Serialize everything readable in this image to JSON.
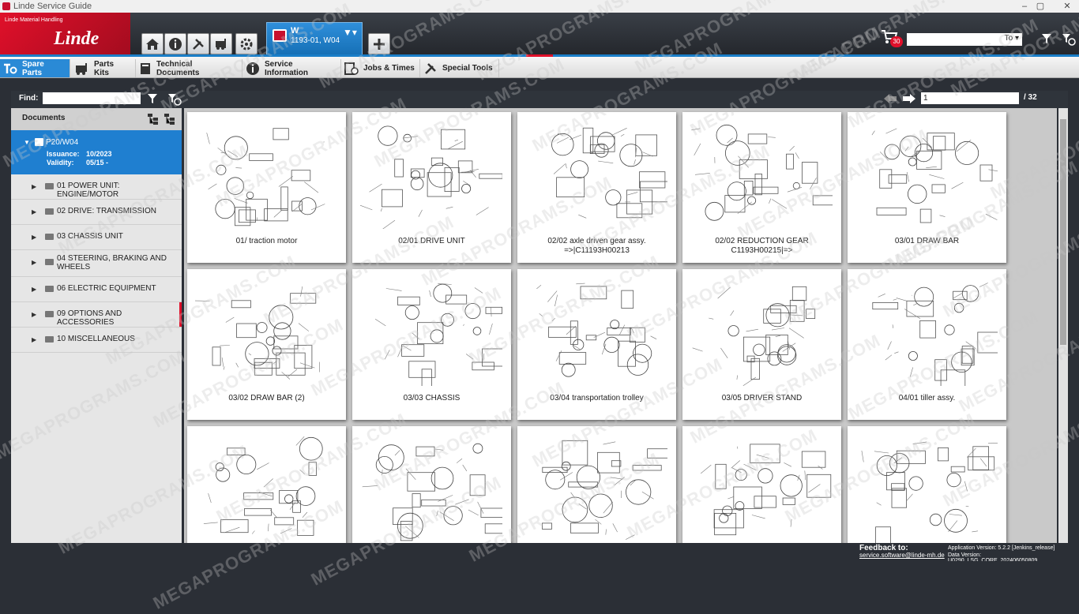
{
  "window": {
    "title": "Linde Service Guide",
    "controls": [
      "–",
      "▢",
      "✕"
    ]
  },
  "brand": {
    "tagline": "Linde Material Handling",
    "logo_text": "Linde"
  },
  "header_buttons": [
    "home-icon",
    "info-icon",
    "tools-icon",
    "truck-icon",
    "settings-icon"
  ],
  "vehicle_tab": {
    "line1": "W",
    "line2": "1193-01, W04"
  },
  "cart": {
    "count": "30"
  },
  "search": {
    "scope": "To"
  },
  "tabs": [
    {
      "label": "Spare Parts",
      "icon": "spare-parts-icon"
    },
    {
      "label": "Parts Kits",
      "icon": "parts-kits-icon"
    },
    {
      "label": "Technical Documents",
      "icon": "book-icon"
    },
    {
      "label": "Service Information",
      "icon": "info-icon"
    },
    {
      "label": "Jobs & Times",
      "icon": "jobs-icon"
    },
    {
      "label": "Special Tools",
      "icon": "tools-icon"
    }
  ],
  "find": {
    "label": "Find:",
    "value": ""
  },
  "pager": {
    "current": "1",
    "total": "/ 32"
  },
  "sidebar": {
    "header": "Documents",
    "document": {
      "name": "P20/W04",
      "issuance_label": "Issuance:",
      "issuance": "10/2023",
      "validity_label": "Validity:",
      "validity": "05/15 -"
    },
    "items": [
      {
        "label": "01 POWER UNIT: ENGINE/MOTOR"
      },
      {
        "label": "02 DRIVE: TRANSMISSION"
      },
      {
        "label": "03 CHASSIS UNIT"
      },
      {
        "label": "04 STEERING, BRAKING AND WHEELS"
      },
      {
        "label": "06 ELECTRIC EQUIPMENT"
      },
      {
        "label": "09 OPTIONS AND ACCESSORIES"
      },
      {
        "label": "10 MISCELLANEOUS"
      }
    ]
  },
  "cards": [
    {
      "caption": "01/ traction motor"
    },
    {
      "caption": "02/01 DRIVE UNIT"
    },
    {
      "caption": "02/02 axle driven gear assy.\n=>|C11193H00213"
    },
    {
      "caption": "02/02 REDUCTION GEAR C1193H00215|=>"
    },
    {
      "caption": "03/01 DRAW BAR"
    },
    {
      "caption": "03/02 DRAW BAR (2)"
    },
    {
      "caption": "03/03 CHASSIS"
    },
    {
      "caption": "03/04 transportation trolley"
    },
    {
      "caption": "03/05 DRIVER STAND"
    },
    {
      "caption": "04/01 tiller assy."
    },
    {
      "caption": ""
    },
    {
      "caption": ""
    },
    {
      "caption": ""
    },
    {
      "caption": ""
    },
    {
      "caption": ""
    }
  ],
  "footer": {
    "feedback_label": "Feedback to:",
    "feedback_email": "service.software@linde-mh.de",
    "app_version": "Application Version:  5.2.2 [Jenkins_release]",
    "data_version": "Data Version:  U0290_LSG_CORE_202406050809"
  },
  "watermark": "MEGAPROGRAMS.COM",
  "colors": {
    "brand_red": "#e0102a",
    "active_blue": "#1f7fd0",
    "dark_bg": "#2b2f36"
  }
}
